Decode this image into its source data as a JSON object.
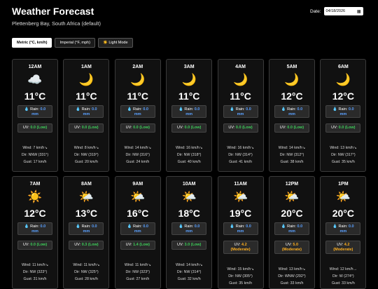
{
  "header": {
    "title": "Weather Forecast",
    "location": "Plettenberg Bay, South Africa (default)",
    "date_label": "Date:",
    "date_value": "04/18/2026"
  },
  "controls": {
    "metric_label": "Metric (°C, km/h)",
    "imperial_label": "Imperial (°F, mph)",
    "light_label": "☀️ Light Mode"
  },
  "labels": {
    "rain": "Rain:",
    "uv": "UV:",
    "wind": "Wind:",
    "dir": "Dir:",
    "gust": "Gust:"
  },
  "hours": [
    {
      "hour": "12AM",
      "icon": "☁️",
      "icon_name": "cloud-icon",
      "temp": "11°C",
      "rain": "0.0",
      "rain_unit": "mm",
      "uv": "0.0",
      "uv_level": "(Low)",
      "wind": "7 km/h↘",
      "dir": "NNW (331°)",
      "gust": "17 km/h"
    },
    {
      "hour": "1AM",
      "icon": "🌙",
      "icon_name": "moon-icon",
      "temp": "11°C",
      "rain": "0.0",
      "rain_unit": "mm",
      "uv": "0.0",
      "uv_level": "(Low)",
      "wind": "8 km/h↘",
      "dir": "NW (319°)",
      "gust": "20 km/h"
    },
    {
      "hour": "2AM",
      "icon": "🌙",
      "icon_name": "moon-icon",
      "temp": "11°C",
      "rain": "0.0",
      "rain_unit": "mm",
      "uv": "0.0",
      "uv_level": "(Low)",
      "wind": "14 km/h↘",
      "dir": "NW (316°)",
      "gust": "24 km/h"
    },
    {
      "hour": "3AM",
      "icon": "🌙",
      "icon_name": "moon-icon",
      "temp": "11°C",
      "rain": "0.0",
      "rain_unit": "mm",
      "uv": "0.0",
      "uv_level": "(Low)",
      "wind": "16 km/h↘",
      "dir": "NW (318°)",
      "gust": "40 km/h"
    },
    {
      "hour": "4AM",
      "icon": "🌙",
      "icon_name": "moon-icon",
      "temp": "11°C",
      "rain": "0.0",
      "rain_unit": "mm",
      "uv": "0.0",
      "uv_level": "(Low)",
      "wind": "16 km/h↘",
      "dir": "NW (314°)",
      "gust": "41 km/h"
    },
    {
      "hour": "5AM",
      "icon": "🌙",
      "icon_name": "moon-icon",
      "temp": "12°C",
      "rain": "0.0",
      "rain_unit": "mm",
      "uv": "0.0",
      "uv_level": "(Low)",
      "wind": "14 km/h↘",
      "dir": "NW (312°)",
      "gust": "38 km/h"
    },
    {
      "hour": "6AM",
      "icon": "🌙",
      "icon_name": "moon-icon",
      "temp": "12°C",
      "rain": "0.0",
      "rain_unit": "mm",
      "uv": "0.0",
      "uv_level": "(Low)",
      "wind": "13 km/h↘",
      "dir": "NW (317°)",
      "gust": "35 km/h"
    },
    {
      "hour": "7AM",
      "icon": "☀️",
      "icon_name": "sun-icon",
      "temp": "12°C",
      "rain": "0.0",
      "rain_unit": "mm",
      "uv": "0.0",
      "uv_level": "(Low)",
      "wind": "11 km/h↘",
      "dir": "NW (323°)",
      "gust": "31 km/h"
    },
    {
      "hour": "8AM",
      "icon": "🌤️",
      "icon_name": "sun-cloud-icon",
      "temp": "13°C",
      "rain": "0.0",
      "rain_unit": "mm",
      "uv": "0.3",
      "uv_level": "(Low)",
      "wind": "11 km/h↘",
      "dir": "NW (325°)",
      "gust": "28 km/h"
    },
    {
      "hour": "9AM",
      "icon": "🌤️",
      "icon_name": "sun-cloud-icon",
      "temp": "16°C",
      "rain": "0.0",
      "rain_unit": "mm",
      "uv": "1.4",
      "uv_level": "(Low)",
      "wind": "11 km/h↘",
      "dir": "NW (323°)",
      "gust": "27 km/h"
    },
    {
      "hour": "10AM",
      "icon": "🌤️",
      "icon_name": "sun-cloud-icon",
      "temp": "18°C",
      "rain": "0.0",
      "rain_unit": "mm",
      "uv": "3.0",
      "uv_level": "(Low)",
      "wind": "14 km/h↘",
      "dir": "NW (314°)",
      "gust": "32 km/h"
    },
    {
      "hour": "11AM",
      "icon": "🌤️",
      "icon_name": "sun-cloud-icon",
      "temp": "19°C",
      "rain": "0.0",
      "rain_unit": "mm",
      "uv": "4.2",
      "uv_level": "(Moderate)",
      "wind": "15 km/h↘",
      "dir": "NW (305°)",
      "gust": "35 km/h"
    },
    {
      "hour": "12PM",
      "icon": "🌤️",
      "icon_name": "sun-cloud-icon",
      "temp": "20°C",
      "rain": "0.0",
      "rain_unit": "mm",
      "uv": "5.0",
      "uv_level": "(Moderate)",
      "wind": "13 km/h↘",
      "dir": "WNW (292°)",
      "gust": "33 km/h"
    },
    {
      "hour": "1PM",
      "icon": "🌤️",
      "icon_name": "sun-cloud-icon",
      "temp": "20°C",
      "rain": "0.0",
      "rain_unit": "mm",
      "uv": "4.2",
      "uv_level": "(Moderate)",
      "wind": "12 km/h→",
      "dir": "W (274°)",
      "gust": "33 km/h"
    }
  ]
}
